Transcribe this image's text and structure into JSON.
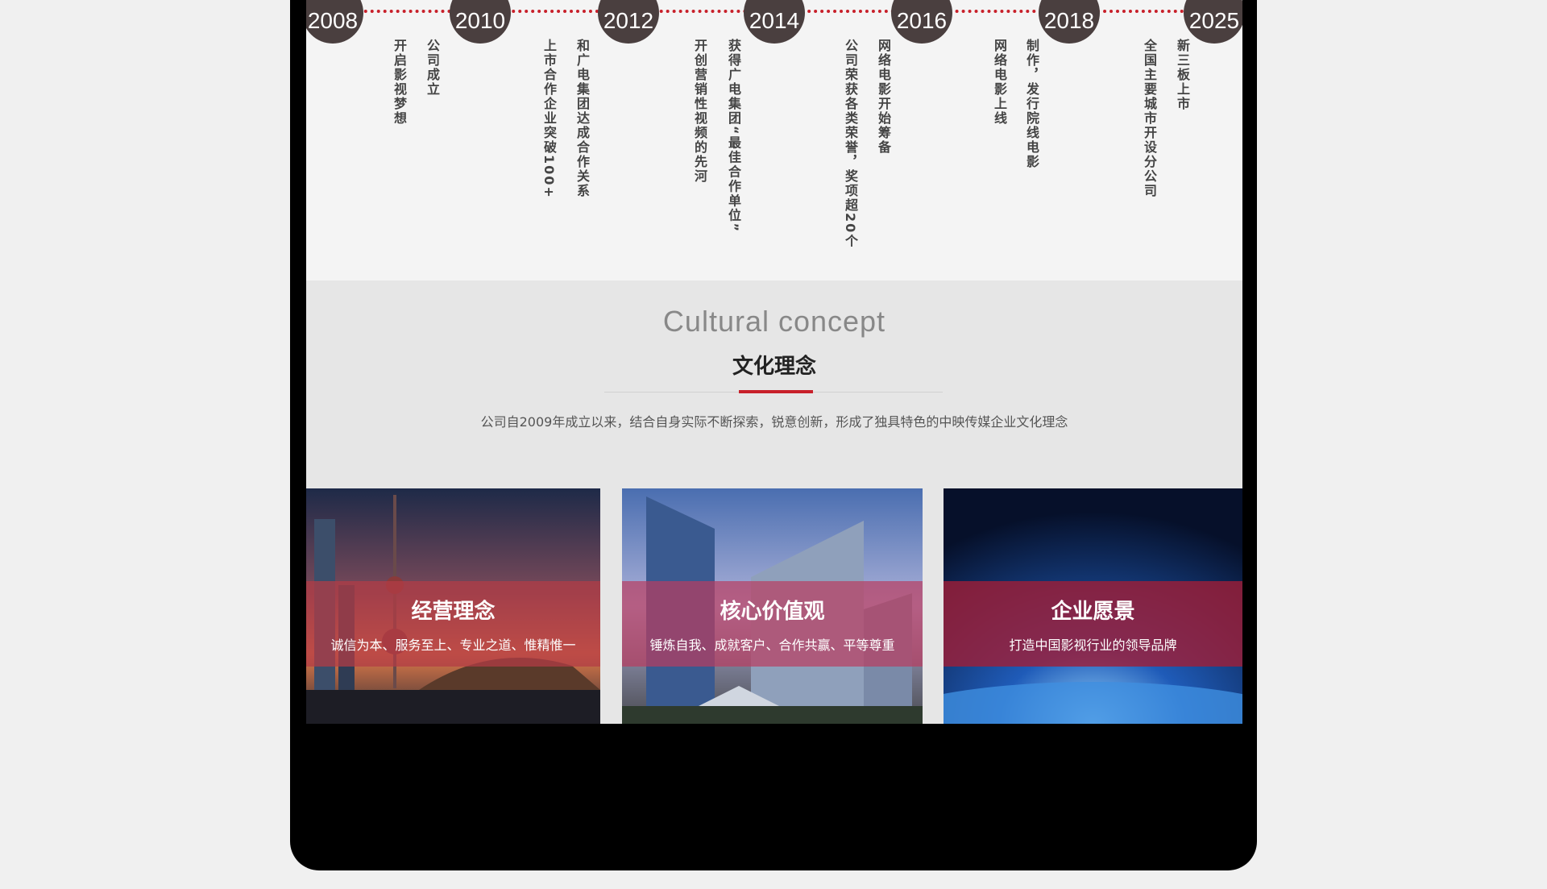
{
  "timeline": [
    {
      "year": "2008",
      "lines": [
        "公司成立",
        "开启影视梦想"
      ]
    },
    {
      "year": "2010",
      "lines": [
        "和广电集团达成合作关系",
        "上市合作企业突破100+"
      ]
    },
    {
      "year": "2012",
      "lines": [
        "获得广电集团“最佳合作单位”",
        "开创营销性视频的先河"
      ]
    },
    {
      "year": "2014",
      "lines": [
        "网络电影开始筹备",
        "公司荣获各类荣誉，奖项超20个"
      ]
    },
    {
      "year": "2016",
      "lines": [
        "制作，发行院线电影",
        "网络电影上线"
      ]
    },
    {
      "year": "2018",
      "lines": [
        "新三板上市",
        "全国主要城市开设分公司"
      ]
    },
    {
      "year": "2025",
      "lines": []
    }
  ],
  "concept": {
    "en_title": "Cultural concept",
    "cn_title": "文化理念",
    "description": "公司自2009年成立以来，结合自身实际不断探索，锐意创新，形成了独具特色的中映传媒企业文化理念"
  },
  "cards": [
    {
      "title": "经营理念",
      "subtitle": "诚信为本、服务至上、专业之道、惟精惟一"
    },
    {
      "title": "核心价值观",
      "subtitle": "锤炼自我、成就客户、合作共赢、平等尊重"
    },
    {
      "title": "企业愿景",
      "subtitle": "打造中国影视行业的领导品牌"
    }
  ],
  "colors": {
    "accent": "#c8202a",
    "year_circle": "#4a3f3f",
    "band": "#b0303c"
  }
}
